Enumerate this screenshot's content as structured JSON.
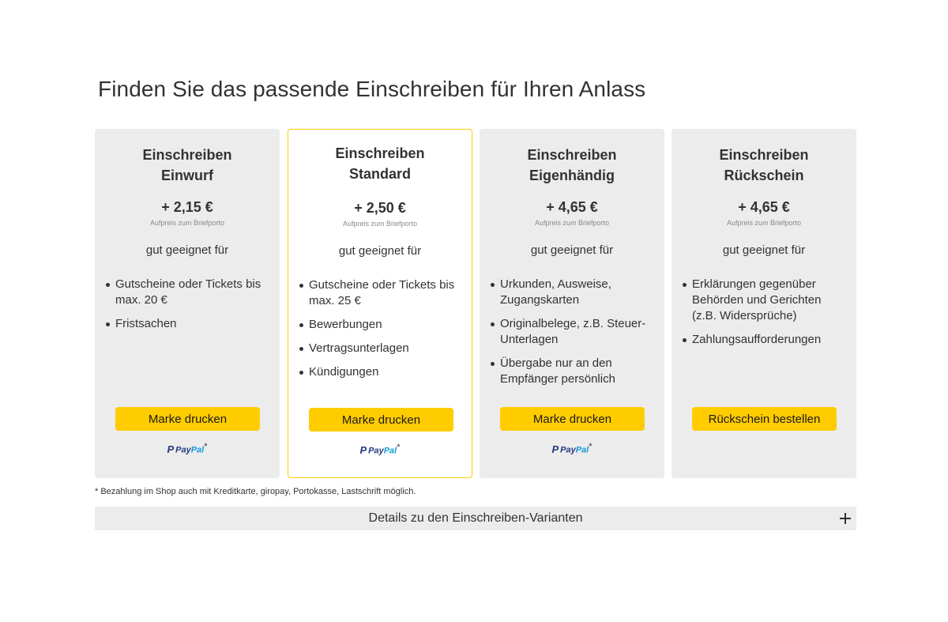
{
  "page": {
    "title": "Finden Sie das passende Einschreiben für Ihren Anlass"
  },
  "colors": {
    "accent": "#ffcc00",
    "card_bg": "#ececec",
    "text": "#323232"
  },
  "cards": [
    {
      "title_line1": "Einschreiben",
      "title_line2": "Einwurf",
      "price": "+ 2,15 €",
      "price_note": "Aufpreis zum Briefporto",
      "suited_label": "gut geeignet für",
      "features": [
        "Gutscheine oder Tickets bis max. 20 €",
        "Fristsachen"
      ],
      "button_label": "Marke drucken",
      "paypal": true
    },
    {
      "title_line1": "Einschreiben",
      "title_line2": "Standard",
      "price": "+ 2,50 €",
      "price_note": "Aufpreis zum Briefporto",
      "suited_label": "gut geeignet für",
      "features": [
        "Gutscheine oder Tickets bis max. 25 €",
        "Bewerbungen",
        "Vertragsunterlagen",
        "Kündigungen"
      ],
      "button_label": "Marke drucken",
      "paypal": true,
      "highlighted": true
    },
    {
      "title_line1": "Einschreiben",
      "title_line2": "Eigenhändig",
      "price": "+ 4,65 €",
      "price_note": "Aufpreis zum Briefporto",
      "suited_label": "gut geeignet für",
      "features": [
        "Urkunden, Ausweise, Zugangskarten",
        "Originalbelege, z.B. Steuer-Unterlagen",
        "Übergabe nur an den Empfänger persönlich"
      ],
      "button_label": "Marke drucken",
      "paypal": true
    },
    {
      "title_line1": "Einschreiben",
      "title_line2": "Rückschein",
      "price": "+ 4,65 €",
      "price_note": "Aufpreis zum Briefporto",
      "suited_label": "gut geeignet für",
      "features": [
        "Erklärungen gegenüber Behörden und Gerichten (z.B. Widersprüche)",
        "Zahlungsaufforderungen"
      ],
      "button_label": "Rückschein bestellen",
      "paypal": false
    }
  ],
  "paypal": {
    "icon": "paypal-logo-icon",
    "word_a": "Pay",
    "word_b": "Pal",
    "star": "*"
  },
  "footnote": "* Bezahlung im Shop auch mit Kreditkarte, giropay, Portokasse, Lastschrift möglich.",
  "details": {
    "label": "Details zu den Einschreiben-Varianten",
    "icon": "plus-icon"
  }
}
